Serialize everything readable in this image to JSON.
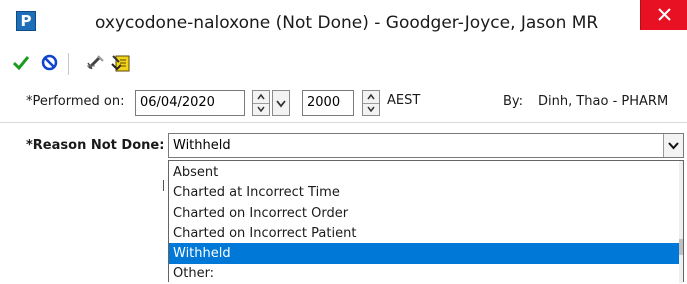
{
  "window": {
    "title": "oxycodone-naloxone (Not Done) - Goodger-Joyce, Jason   MR",
    "app_icon_letter": "P"
  },
  "toolbar": {
    "buttons": [
      "sign-checkmark",
      "cancel-not-allowed",
      "chart-pen",
      "chart-notes"
    ]
  },
  "performed": {
    "label": "*Performed on:",
    "date": "06/04/2020",
    "time": "2000",
    "timezone": "AEST",
    "by_label": "By:",
    "by_value": "Dinh, Thao  - PHARM"
  },
  "reason": {
    "label": "*Reason Not Done:",
    "selected": "Withheld",
    "options": [
      "Absent",
      "Charted at Incorrect Time",
      "Charted on Incorrect Order",
      "Charted on Incorrect Patient",
      "Withheld",
      "Other:"
    ],
    "highlighted_index": 4
  },
  "colors": {
    "accent": "#0078d7",
    "close": "#e81123",
    "app_icon": "#1f6fb8"
  }
}
